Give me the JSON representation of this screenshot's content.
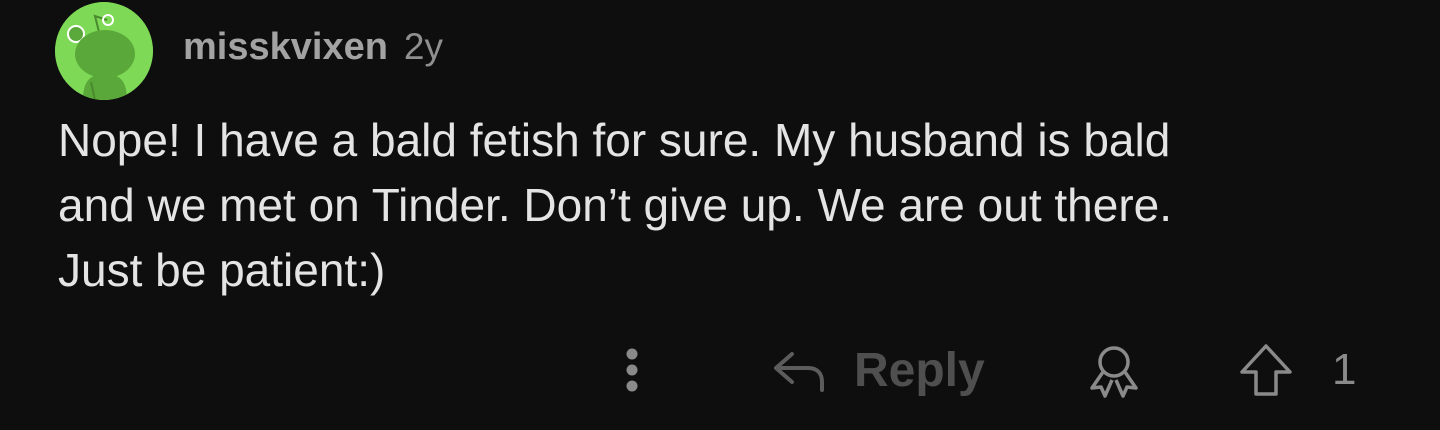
{
  "comment": {
    "username": "misskvixen",
    "age": "2y",
    "body_lines": [
      "Nope! I have a bald fetish for sure. My husband is bald",
      "and we met on Tinder. Don’t give up. We are out there.",
      "Just be patient:)"
    ],
    "avatar_color": "#7ed957"
  },
  "actions": {
    "more_icon": "more-vertical-icon",
    "reply_icon": "reply-arrow-icon",
    "reply_label": "Reply",
    "award_icon": "award-icon",
    "upvote_icon": "upvote-arrow-icon",
    "vote_count": "1"
  }
}
